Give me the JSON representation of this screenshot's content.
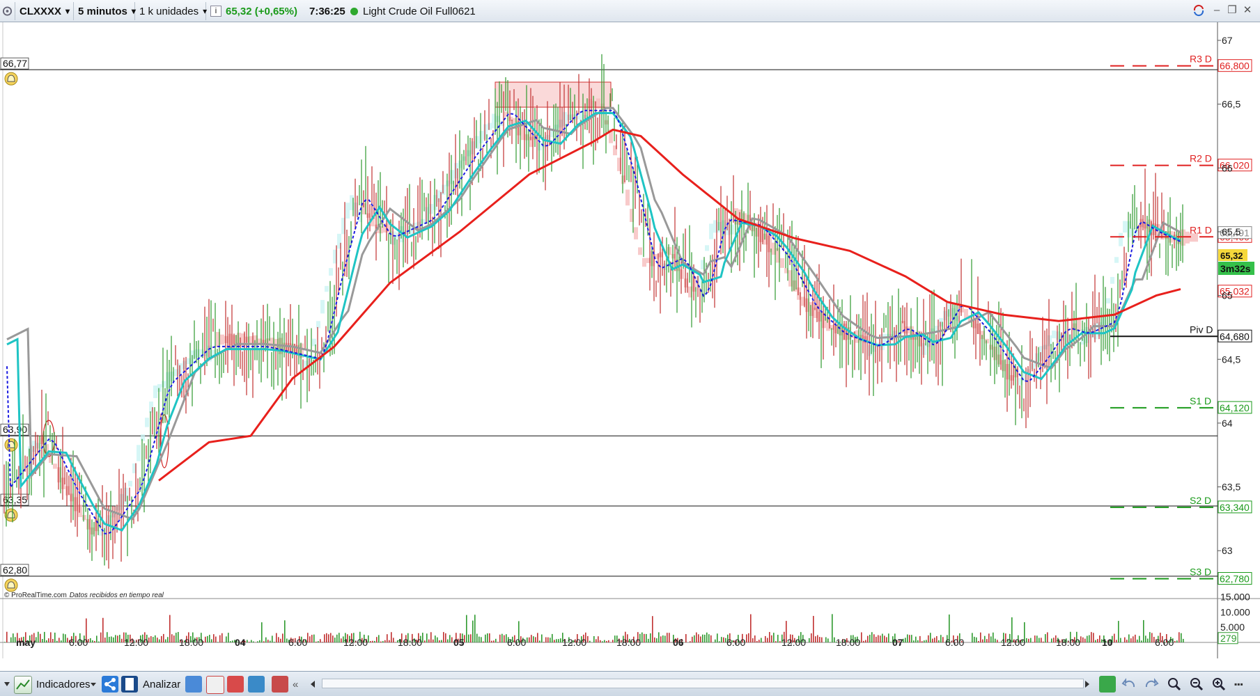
{
  "toolbar": {
    "symbol": "CLXXXX",
    "timeframe": "5 minutos",
    "units": "1 k unidades",
    "info_icon_label": "i",
    "price_change": "65,32 (+0,65%)",
    "time": "7:36:25",
    "instrument": "Light Crude Oil Full0621"
  },
  "chart": {
    "watermark": "© ProRealTime.com",
    "realtime_note": "Datos recibidos en tiempo real",
    "countdown": "3m32s",
    "current_price": "65,32",
    "price_axis": [
      "67",
      "66,5",
      "66",
      "65,5",
      "65",
      "64,5",
      "64",
      "63,5",
      "63"
    ],
    "alert_levels": [
      {
        "label": "66,77",
        "icon": "bell-icon"
      },
      {
        "label": "63,90",
        "icon": "bell-icon"
      },
      {
        "label": "63,35",
        "icon": "bell-icon"
      },
      {
        "label": "62,80",
        "icon": "bell-icon"
      }
    ],
    "pivots": [
      {
        "name": "R3 D",
        "value": "66,800",
        "color": "#e02020"
      },
      {
        "name": "R2 D",
        "value": "66,020",
        "color": "#e02020"
      },
      {
        "name": "R1 D",
        "value": "65,460",
        "color": "#e02020"
      },
      {
        "name": "Piv D",
        "value": "64,680",
        "color": "#111111"
      },
      {
        "name": "S1 D",
        "value": "64,120",
        "color": "#1a9a1a"
      },
      {
        "name": "S2 D",
        "value": "63,340",
        "color": "#1a9a1a"
      },
      {
        "name": "S3 D",
        "value": "62,780",
        "color": "#1a9a1a"
      }
    ],
    "other_axis_labels": [
      {
        "value": "65,491",
        "color": "#888888"
      },
      {
        "value": "65,032",
        "color": "#e02020"
      }
    ],
    "time_axis": [
      "may",
      "6:00",
      "12:00",
      "18:00",
      "04",
      "6:00",
      "12:00",
      "18:00",
      "05",
      "6:00",
      "12:00",
      "18:00",
      "06",
      "6:00",
      "12:00",
      "18:00",
      "07",
      "6:00",
      "12:00",
      "18:00",
      "10",
      "6:00"
    ],
    "volume_axis": [
      "15.000",
      "10.000",
      "5.000",
      "279"
    ],
    "colors": {
      "ma_red": "#e8201c",
      "ma_cyan": "#1fc4c4",
      "ma_gray": "#999999",
      "ma_blue": "#1a1ae0",
      "candle_up": "#2e9a2e",
      "candle_down": "#c03030",
      "cloud_red": "#f5b8b8",
      "cloud_cyan": "#c8f3f3"
    },
    "chart_data": {
      "type": "line",
      "approx_price_path": {
        "x": [
          "may 6:00",
          "may 12:00",
          "may 18:00",
          "04 6:00",
          "04 12:00",
          "04 18:00",
          "05 6:00",
          "05 12:00",
          "05 18:00",
          "06 6:00",
          "06 12:00",
          "06 18:00",
          "07 6:00",
          "07 12:00",
          "07 18:00",
          "10 6:00"
        ],
        "close": [
          63.55,
          63.25,
          64.45,
          64.6,
          65.8,
          65.6,
          66.4,
          66.45,
          65.9,
          65.2,
          65.7,
          64.8,
          64.7,
          64.5,
          64.8,
          65.32
        ]
      }
    }
  },
  "bottombar": {
    "collapse_label": "«",
    "indicators_label": "Indicadores",
    "analyze_label": "Analizar",
    "scroll_left": "«"
  }
}
